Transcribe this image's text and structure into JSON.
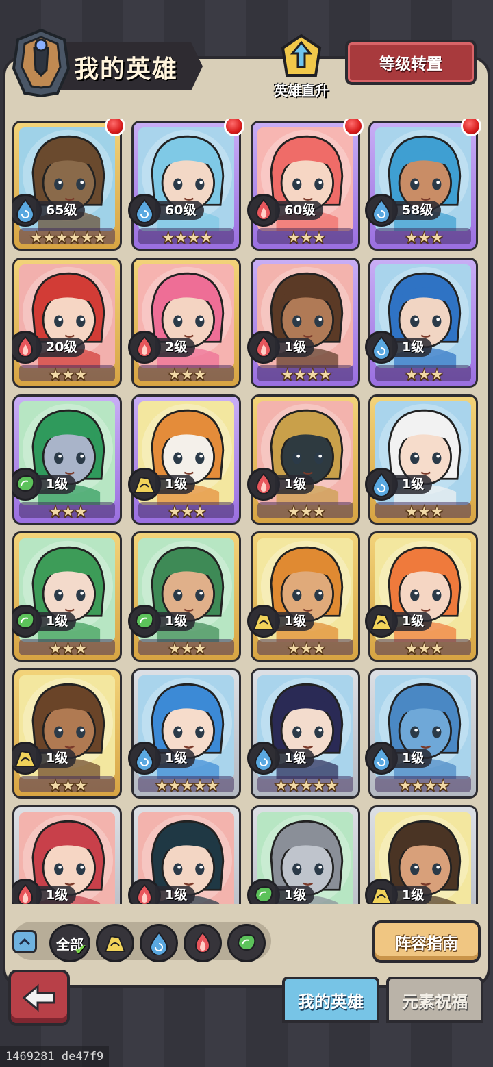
{
  "header": {
    "title": "我的英雄",
    "direct_upgrade_label": "英雄直升",
    "level_reset_label": "等级转置"
  },
  "heroes": [
    {
      "level": "65级",
      "element": "water",
      "stars": "★★★★★★",
      "frame": "gold",
      "skin": "#8a6a4a",
      "hair": "#6a4a2e",
      "bg": "#9fd2e8",
      "alert": true
    },
    {
      "level": "60级",
      "element": "water",
      "stars": "★★★★",
      "frame": "purple",
      "skin": "#f3d8c6",
      "hair": "#7fc9e6",
      "bg": "#a9d4ec",
      "alert": true
    },
    {
      "level": "60级",
      "element": "fire",
      "stars": "★★★",
      "frame": "purple",
      "skin": "#f6d6c4",
      "hair": "#ef6c68",
      "bg": "#f7b6b2",
      "alert": true
    },
    {
      "level": "58级",
      "element": "water",
      "stars": "★★★",
      "frame": "purple",
      "skin": "#c98d66",
      "hair": "#3f9fd2",
      "bg": "#a9d4ec",
      "alert": true
    },
    {
      "level": "20级",
      "element": "fire",
      "stars": "★★★",
      "frame": "gold",
      "skin": "#f6d6c4",
      "hair": "#d23c36",
      "bg": "#f2b0ad",
      "alert": false
    },
    {
      "level": "2级",
      "element": "fire",
      "stars": "★★★",
      "frame": "gold",
      "skin": "#f4d4c2",
      "hair": "#ee6e96",
      "bg": "#f6b3b0",
      "alert": false
    },
    {
      "level": "1级",
      "element": "fire",
      "stars": "★★★★",
      "frame": "purple",
      "skin": "#b07a56",
      "hair": "#5b3a26",
      "bg": "#f3b3ad",
      "alert": false
    },
    {
      "level": "1级",
      "element": "water",
      "stars": "★★★",
      "frame": "purple",
      "skin": "#f1d5c3",
      "hair": "#2f73c4",
      "bg": "#a9d4ec",
      "alert": false
    },
    {
      "level": "1级",
      "element": "nature",
      "stars": "★★★",
      "frame": "purple",
      "skin": "#a9b4c9",
      "hair": "#2f9a5c",
      "bg": "#b7e6c3",
      "alert": false
    },
    {
      "level": "1级",
      "element": "earth",
      "stars": "★★★",
      "frame": "purple",
      "skin": "#f4f0ea",
      "hair": "#e48c3a",
      "bg": "#f3e79f",
      "alert": false
    },
    {
      "level": "1级",
      "element": "fire",
      "stars": "★★★",
      "frame": "gold",
      "skin": "#2e3a40",
      "hair": "#c9a04a",
      "bg": "#f3b3ad",
      "alert": false
    },
    {
      "level": "1级",
      "element": "water",
      "stars": "★★★",
      "frame": "gold",
      "skin": "#f6dccb",
      "hair": "#f2f2f2",
      "bg": "#a9d4ec",
      "alert": false
    },
    {
      "level": "1级",
      "element": "nature",
      "stars": "★★★",
      "frame": "gold",
      "skin": "#f3dacb",
      "hair": "#3d9c58",
      "bg": "#b7e6c3",
      "alert": false
    },
    {
      "level": "1级",
      "element": "nature",
      "stars": "★★★",
      "frame": "gold",
      "skin": "#e0b08a",
      "hair": "#3e8a56",
      "bg": "#b7e6c3",
      "alert": false
    },
    {
      "level": "1级",
      "element": "earth",
      "stars": "★★★",
      "frame": "gold",
      "skin": "#e0aa7a",
      "hair": "#e08a32",
      "bg": "#f3e79f",
      "alert": false
    },
    {
      "level": "1级",
      "element": "earth",
      "stars": "★★★",
      "frame": "gold",
      "skin": "#f5d6c3",
      "hair": "#ef7a3c",
      "bg": "#f3e79f",
      "alert": false
    },
    {
      "level": "1级",
      "element": "earth",
      "stars": "★★★",
      "frame": "gold",
      "skin": "#b07a52",
      "hair": "#6a4428",
      "bg": "#f3e79f",
      "alert": false
    },
    {
      "level": "1级",
      "element": "water",
      "stars": "★★★★★",
      "frame": "silver",
      "skin": "#f6dccb",
      "hair": "#3c8ad6",
      "bg": "#a9d4ec",
      "alert": false
    },
    {
      "level": "1级",
      "element": "water",
      "stars": "★★★★★",
      "frame": "silver",
      "skin": "#f3dccd",
      "hair": "#2a2a55",
      "bg": "#a9d4ec",
      "alert": false
    },
    {
      "level": "1级",
      "element": "water",
      "stars": "★★★★",
      "frame": "silver",
      "skin": "#6fa8d8",
      "hair": "#4a88c4",
      "bg": "#a9d4ec",
      "alert": false
    },
    {
      "level": "1级",
      "element": "fire",
      "stars": "",
      "frame": "silver",
      "skin": "#f6d6c4",
      "hair": "#c8404a",
      "bg": "#f3b3ad",
      "alert": false
    },
    {
      "level": "1级",
      "element": "fire",
      "stars": "",
      "frame": "silver",
      "skin": "#f3d6c4",
      "hair": "#1f3844",
      "bg": "#f3b3ad",
      "alert": false
    },
    {
      "level": "1级",
      "element": "nature",
      "stars": "",
      "frame": "silver",
      "skin": "#bfc4cc",
      "hair": "#8a8f98",
      "bg": "#b7e6c3",
      "alert": false
    },
    {
      "level": "1级",
      "element": "earth",
      "stars": "",
      "frame": "silver",
      "skin": "#d8a07a",
      "hair": "#4a3424",
      "bg": "#f3e79f",
      "alert": false
    }
  ],
  "filters": {
    "all_label": "全部",
    "elements": [
      "earth",
      "water",
      "fire",
      "nature"
    ]
  },
  "buttons": {
    "lineup_guide": "阵容指南"
  },
  "tabs": {
    "my_heroes": "我的英雄",
    "element_blessing": "元素祝福"
  },
  "debug_id": "1469281 de47f9",
  "colors": {
    "water": "#5aa8e0",
    "fire": "#e8565c",
    "nature": "#5cc25a",
    "earth": "#f1d35a"
  }
}
